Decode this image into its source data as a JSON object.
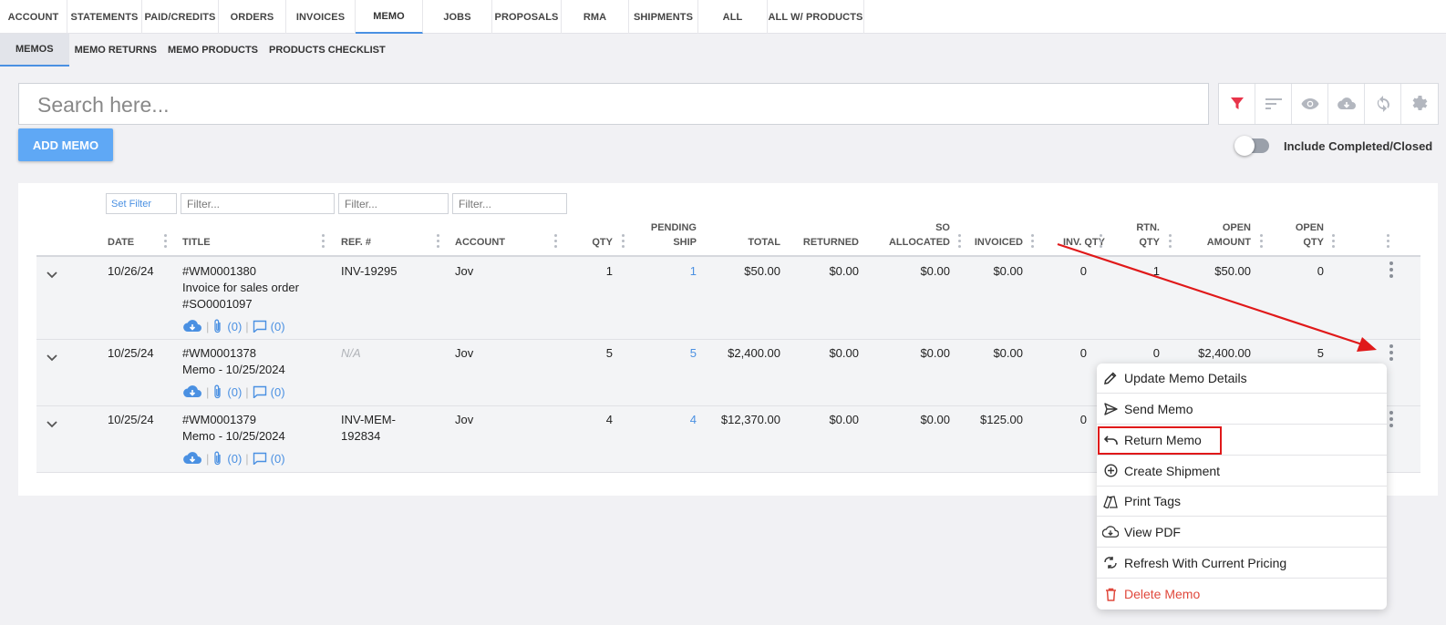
{
  "top_tabs": [
    "ACCOUNT",
    "STATEMENTS",
    "PAID/CREDITS",
    "ORDERS",
    "INVOICES",
    "MEMO",
    "JOBS",
    "PROPOSALS",
    "RMA",
    "SHIPMENTS",
    "ALL",
    "ALL W/ PRODUCTS"
  ],
  "active_top_tab": "MEMO",
  "sub_tabs": [
    "MEMOS",
    "MEMO RETURNS",
    "MEMO PRODUCTS",
    "PRODUCTS CHECKLIST"
  ],
  "search": {
    "placeholder": "Search here..."
  },
  "toolbar_icons": [
    "filter-icon",
    "sort-icon",
    "eye-icon",
    "cloud-download-icon",
    "sync-icon",
    "gear-icon"
  ],
  "add_button": "ADD MEMO",
  "toggle_label": "Include Completed/Closed",
  "filters": {
    "set_filter": "Set Filter",
    "placeholder": "Filter..."
  },
  "columns": {
    "date": "DATE",
    "title": "TITLE",
    "ref": "REF. #",
    "account": "ACCOUNT",
    "qty": "QTY",
    "pending_ship": [
      "PENDING",
      "SHIP"
    ],
    "total": "TOTAL",
    "returned": "RETURNED",
    "so_allocated": [
      "SO",
      "ALLOCATED"
    ],
    "invoiced": "INVOICED",
    "inv_qty": "INV. QTY",
    "rtn_qty": [
      "RTN.",
      "QTY"
    ],
    "open_amount": [
      "OPEN",
      "AMOUNT"
    ],
    "open_qty": [
      "OPEN",
      "QTY"
    ]
  },
  "rows": [
    {
      "date": "10/26/24",
      "title": [
        "#WM0001380",
        "Invoice for sales order",
        "#SO0001097"
      ],
      "ref": "INV-19295",
      "account": "Jov",
      "qty": "1",
      "pending_ship": "1",
      "total": "$50.00",
      "returned": "$0.00",
      "so_allocated": "$0.00",
      "invoiced": "$0.00",
      "inv_qty": "0",
      "rtn_qty": "1",
      "open_amount": "$50.00",
      "open_qty": "0",
      "attachments": "(0)",
      "comments": "(0)"
    },
    {
      "date": "10/25/24",
      "title": [
        "#WM0001378",
        "Memo - 10/25/2024"
      ],
      "ref": "N/A",
      "account": "Jov",
      "qty": "5",
      "pending_ship": "5",
      "total": "$2,400.00",
      "returned": "$0.00",
      "so_allocated": "$0.00",
      "invoiced": "$0.00",
      "inv_qty": "0",
      "rtn_qty": "0",
      "open_amount": "$2,400.00",
      "open_qty": "5",
      "attachments": "(0)",
      "comments": "(0)"
    },
    {
      "date": "10/25/24",
      "title": [
        "#WM0001379",
        "Memo - 10/25/2024"
      ],
      "ref": [
        "INV-MEM-",
        "192834"
      ],
      "account": "Jov",
      "qty": "4",
      "pending_ship": "4",
      "total": "$12,370.00",
      "returned": "$0.00",
      "so_allocated": "$0.00",
      "invoiced": "$125.00",
      "inv_qty": "0",
      "attachments": "(0)",
      "comments": "(0)"
    }
  ],
  "context_menu": [
    {
      "label": "Update Memo Details",
      "icon": "pencil-icon"
    },
    {
      "label": "Send Memo",
      "icon": "send-icon"
    },
    {
      "label": "Return Memo",
      "icon": "undo-icon"
    },
    {
      "label": "Create Shipment",
      "icon": "plus-circle-icon"
    },
    {
      "label": "Print Tags",
      "icon": "tags-icon"
    },
    {
      "label": "View PDF",
      "icon": "cloud-download-icon"
    },
    {
      "label": "Refresh With Current Pricing",
      "icon": "refresh-price-icon"
    },
    {
      "label": "Delete Memo",
      "icon": "trash-icon",
      "danger": true
    }
  ],
  "colors": {
    "accent": "#4a90e2",
    "button": "#5fa8f5",
    "danger": "#e0483c",
    "annotation": "#e0191a",
    "filter_active": "#e8344a"
  }
}
